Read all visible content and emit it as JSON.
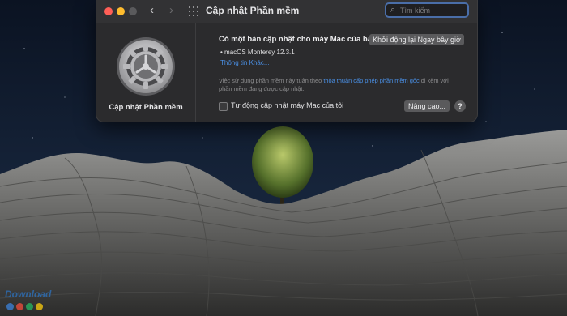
{
  "window": {
    "title": "Cập nhật Phần mềm",
    "search_placeholder": "Tìm kiếm"
  },
  "left_pane": {
    "label": "Cập nhật Phần mềm",
    "icon": "gear-icon"
  },
  "update": {
    "headline": "Có một bản cập nhật cho máy Mac của bạn",
    "restart_label": "Khởi động lại Ngay bây giờ",
    "item": "• macOS Monterey 12.3.1",
    "more_info": "Thông tin Khác...",
    "legal_prefix": "Việc sử dụng phần mềm này tuân theo ",
    "legal_link": "thỏa thuận cấp phép phần mềm gốc",
    "legal_suffix": " đi kèm với phần mềm đang được cập nhật."
  },
  "footer": {
    "auto_update_label": "Tự động cập nhật máy Mac của tôi",
    "auto_update_checked": false,
    "advanced_label": "Nâng cao...",
    "help_label": "?"
  },
  "watermark": {
    "text": "Download"
  },
  "colors": {
    "accent": "#4a90e6",
    "window_bg": "#2b2b2d",
    "close": "#ff5f57",
    "minimize": "#febc2e"
  }
}
